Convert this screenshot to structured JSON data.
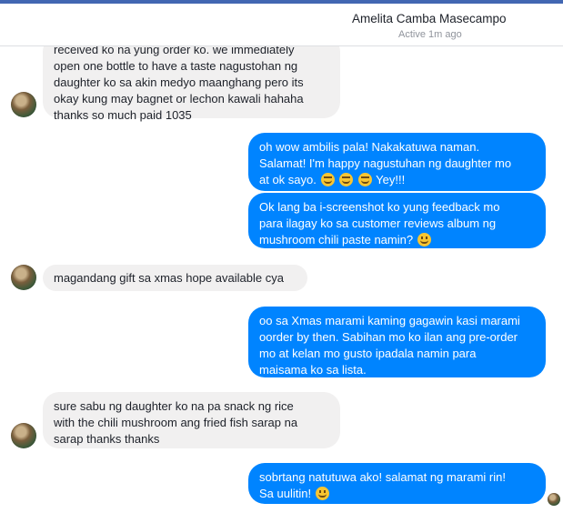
{
  "header": {
    "contact_name": "Amelita Camba Masecampo",
    "status": "Active 1m ago"
  },
  "messages": [
    {
      "direction": "incoming",
      "lines": [
        "received ko na yung order ko. we immediately",
        "open one bottle to have a taste nagustohan ng",
        "daughter ko sa akin medyo maanghang pero its",
        "okay kung may bagnet or lechon kawali hahaha",
        "thanks so much paid 1035"
      ]
    },
    {
      "direction": "outgoing",
      "lines": [
        "oh wow ambilis pala! Nakakatuwa naman.",
        "Salamat! I'm happy nagustuhan ng daughter mo",
        "at ok sayo.",
        "Yey!!!"
      ],
      "emojis": [
        "grinning-emoji",
        "grinning-emoji",
        "grinning-emoji"
      ]
    },
    {
      "direction": "outgoing",
      "lines": [
        "Ok lang ba i-screenshot ko yung feedback mo",
        "para ilagay ko sa customer reviews album ng",
        "mushroom chili paste namin?"
      ],
      "emojis": [
        "smiling-emoji"
      ]
    },
    {
      "direction": "incoming",
      "lines": [
        "magandang gift sa xmas hope available cya"
      ]
    },
    {
      "direction": "outgoing",
      "lines": [
        "oo sa Xmas marami kaming gagawin kasi marami",
        "oorder by then. Sabihan mo ko ilan ang pre-order",
        "mo at kelan mo gusto ipadala namin para",
        "maisama ko sa lista."
      ]
    },
    {
      "direction": "incoming",
      "lines": [
        "sure sabu ng daughter ko na pa snack ng rice",
        "with the chili mushroom ang fried fish sarap na",
        "sarap thanks thanks"
      ]
    },
    {
      "direction": "outgoing",
      "lines": [
        "sobrtang natutuwa ako! salamat ng marami rin!",
        "Sa uulitin!"
      ],
      "emojis": [
        "blushing-emoji"
      ]
    }
  ],
  "colors": {
    "outgoing_bubble": "#0084ff",
    "incoming_bubble": "#f1f0f0",
    "topbar": "#4267b2"
  }
}
